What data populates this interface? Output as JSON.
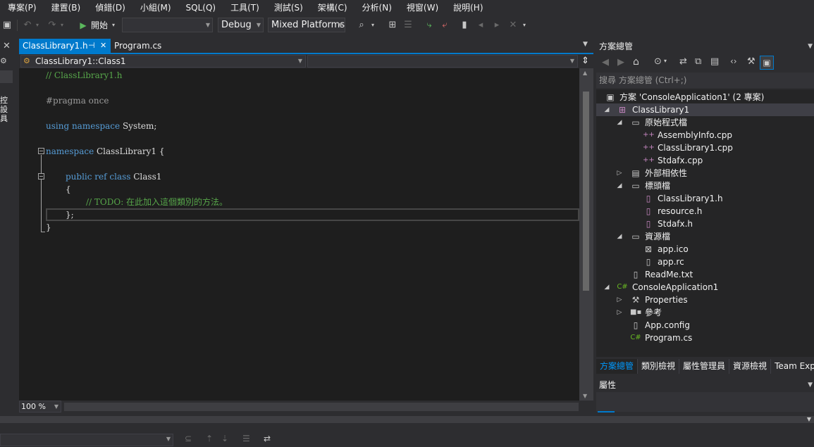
{
  "menu": [
    "專案(P)",
    "建置(B)",
    "偵錯(D)",
    "小組(M)",
    "SQL(Q)",
    "工具(T)",
    "測試(S)",
    "架構(C)",
    "分析(N)",
    "視窗(W)",
    "說明(H)"
  ],
  "toolbar": {
    "start_label": "開始",
    "config_combo": "Debug",
    "platform_combo": "Mixed Platforms"
  },
  "left_strip": {
    "vertical_label": "控\n設\n具"
  },
  "editor": {
    "tabs": [
      {
        "label": "ClassLibrary1.h",
        "pin": "⊣",
        "close": "✕"
      },
      {
        "label": "Program.cs"
      }
    ],
    "nav_scope": "ClassLibrary1::Class1",
    "zoom": "100 %",
    "code": {
      "line1": "// ClassLibrary1.h",
      "line3": "#pragma once",
      "line5_kw": "using namespace",
      "line5_rest": " System;",
      "line7_kw": "namespace",
      "line7_rest": " ClassLibrary1 {",
      "line9_kw": "public ref class",
      "line9_rest": " Class1",
      "line10": "{",
      "line11": "// TODO: 在此加入這個類別的方法。",
      "line12": "};",
      "line13": "}"
    }
  },
  "solution_explorer": {
    "title": "方案總管",
    "search_placeholder": "搜尋 方案總管 (Ctrl+;)",
    "tree": {
      "solution": "方案 'ConsoleApplication1' (2 專案)",
      "project1": "ClassLibrary1",
      "source_folder": "原始程式檔",
      "assemblyinfo": "AssemblyInfo.cpp",
      "classlib_cpp": "ClassLibrary1.cpp",
      "stdafx_cpp": "Stdafx.cpp",
      "external_deps": "外部相依性",
      "header_folder": "標頭檔",
      "classlib_h": "ClassLibrary1.h",
      "resource_h": "resource.h",
      "stdafx_h": "Stdafx.h",
      "resource_folder": "資源檔",
      "app_ico": "app.ico",
      "app_rc": "app.rc",
      "readme": "ReadMe.txt",
      "project2": "ConsoleApplication1",
      "properties": "Properties",
      "references": "參考",
      "app_config": "App.config",
      "program_cs": "Program.cs"
    },
    "tabs": [
      "方案總管",
      "類別檢視",
      "屬性管理員",
      "資源檢視",
      "Team Explo"
    ]
  },
  "properties_panel": {
    "title": "屬性"
  },
  "colors": {
    "accent": "#007acc",
    "background": "#2d2d30",
    "editor_bg": "#1e1e1e",
    "keyword": "#569cd6",
    "comment": "#57a64a"
  }
}
